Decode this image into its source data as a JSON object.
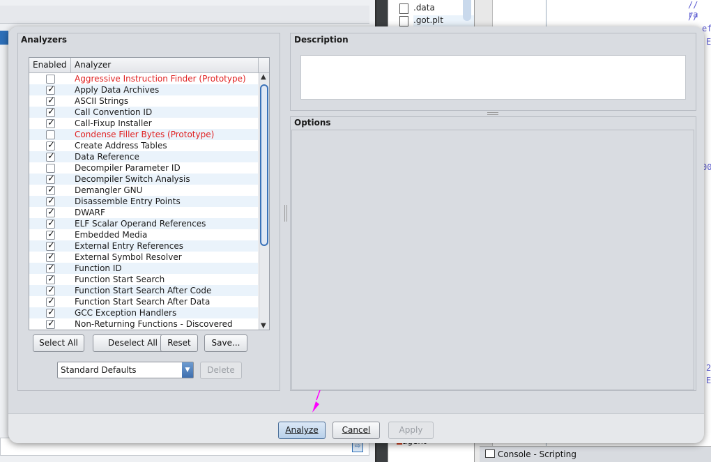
{
  "background": {
    "tree_items": [
      ".data",
      ".got.plt"
    ],
    "tree_bottom_item": "agent",
    "code_lines": [
      "// ra",
      "//",
      "ef",
      "E",
      "00",
      "2",
      "E"
    ],
    "console_title": "Console - Scripting"
  },
  "analyzers_panel": {
    "title": "Analyzers",
    "columns": [
      "Enabled",
      "Analyzer"
    ],
    "items": [
      {
        "label": "Aggressive Instruction Finder (Prototype)",
        "enabled": false,
        "prototype": true
      },
      {
        "label": "Apply Data Archives",
        "enabled": true,
        "prototype": false
      },
      {
        "label": "ASCII Strings",
        "enabled": true,
        "prototype": false
      },
      {
        "label": "Call Convention ID",
        "enabled": true,
        "prototype": false
      },
      {
        "label": "Call-Fixup Installer",
        "enabled": true,
        "prototype": false
      },
      {
        "label": "Condense Filler Bytes (Prototype)",
        "enabled": false,
        "prototype": true
      },
      {
        "label": "Create Address Tables",
        "enabled": true,
        "prototype": false
      },
      {
        "label": "Data Reference",
        "enabled": true,
        "prototype": false
      },
      {
        "label": "Decompiler Parameter ID",
        "enabled": false,
        "prototype": false
      },
      {
        "label": "Decompiler Switch Analysis",
        "enabled": true,
        "prototype": false
      },
      {
        "label": "Demangler GNU",
        "enabled": true,
        "prototype": false
      },
      {
        "label": "Disassemble Entry Points",
        "enabled": true,
        "prototype": false
      },
      {
        "label": "DWARF",
        "enabled": true,
        "prototype": false
      },
      {
        "label": "ELF Scalar Operand References",
        "enabled": true,
        "prototype": false
      },
      {
        "label": "Embedded Media",
        "enabled": true,
        "prototype": false
      },
      {
        "label": "External Entry References",
        "enabled": true,
        "prototype": false
      },
      {
        "label": "External Symbol Resolver",
        "enabled": true,
        "prototype": false
      },
      {
        "label": "Function ID",
        "enabled": true,
        "prototype": false
      },
      {
        "label": "Function Start Search",
        "enabled": true,
        "prototype": false
      },
      {
        "label": "Function Start Search After Code",
        "enabled": true,
        "prototype": false
      },
      {
        "label": "Function Start Search After Data",
        "enabled": true,
        "prototype": false
      },
      {
        "label": "GCC Exception Handlers",
        "enabled": true,
        "prototype": false
      },
      {
        "label": "Non-Returning Functions - Discovered",
        "enabled": true,
        "prototype": false
      }
    ],
    "buttons": {
      "select_all": "Select All",
      "deselect_all": "Deselect All",
      "reset": "Reset",
      "save": "Save..."
    },
    "profile_select": "Standard Defaults",
    "delete_button": "Delete"
  },
  "description_panel": {
    "title": "Description",
    "text": ""
  },
  "options_panel": {
    "title": "Options"
  },
  "footer": {
    "analyze": "Analyze",
    "cancel": "Cancel",
    "apply": "Apply"
  },
  "colors": {
    "prototype_text": "#e02020",
    "normal_text": "#1a1a1a",
    "accent": "#3a72b8",
    "cursor": "#ff00ff"
  }
}
